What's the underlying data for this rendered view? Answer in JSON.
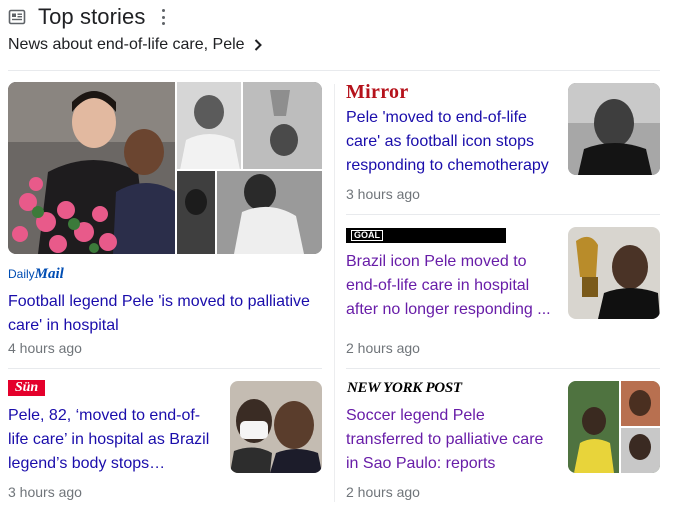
{
  "header": {
    "title": "Top stories",
    "subtitle": "News about end-of-life care, Pele"
  },
  "icons": {
    "news": "news-icon",
    "more": "more-vert-icon",
    "chevron": "chevron-right-icon"
  },
  "colors": {
    "link": "#1a0dab",
    "visited": "#681da8",
    "meta": "#70757a"
  },
  "stories": [
    {
      "publisher": "Daily Mail",
      "logo_text": {
        "a": "Daily",
        "b": "Mail"
      },
      "headline": "Football legend Pele 'is moved to palliative care' in hospital",
      "time": "4 hours ago",
      "visited": false
    },
    {
      "publisher": "Mirror",
      "logo_text": "Mirror",
      "headline": "Pele 'moved to end-of-life care' as football icon stops responding to chemotherapy",
      "time": "3 hours ago",
      "visited": false
    },
    {
      "publisher": "Goal",
      "logo_text": "GOAL",
      "headline": "Brazil icon Pele moved to end-of-life care in hospital after no longer responding ...",
      "time": "2 hours ago",
      "visited": true
    },
    {
      "publisher": "The Sun",
      "logo_text": "Sün",
      "headline": "Pele, 82, ‘moved to end-of-life care’ in hospital as Brazil legend’s body stops…",
      "time": "3 hours ago",
      "visited": false
    },
    {
      "publisher": "New York Post",
      "logo_text": "NEW YORK POST",
      "headline": "Soccer legend Pele transferred to palliative care in Sao Paulo: reports",
      "time": "2 hours ago",
      "visited": true
    }
  ]
}
